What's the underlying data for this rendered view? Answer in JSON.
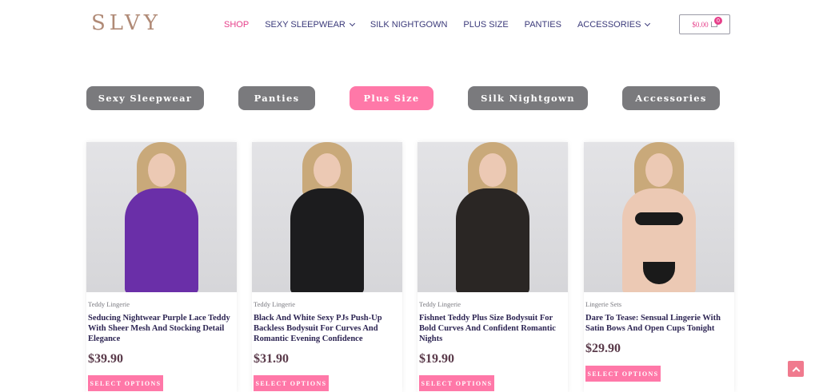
{
  "header": {
    "logo": "SLVY",
    "nav": [
      {
        "label": "SHOP",
        "active": true
      },
      {
        "label": "SEXY SLEEPWEAR",
        "dropdown": true
      },
      {
        "label": "SILK NIGHTGOWN"
      },
      {
        "label": "PLUS SIZE"
      },
      {
        "label": "PANTIES"
      },
      {
        "label": "ACCESSORIES",
        "dropdown": true
      }
    ],
    "cart_total": "$0.00",
    "cart_count": "0"
  },
  "categories": [
    {
      "label": "Sexy Sleepwear",
      "active": false
    },
    {
      "label": "Panties",
      "active": false
    },
    {
      "label": "Plus Size",
      "active": true
    },
    {
      "label": "Silk Nightgown",
      "active": false
    },
    {
      "label": "Accessories",
      "active": false
    }
  ],
  "products": [
    {
      "category": "Teddy Lingerie",
      "title": "Seducing Nightwear Purple Lace Teddy With Sheer Mesh And Stocking Detail Elegance",
      "price": "$39.90",
      "button": "SELECT OPTIONS",
      "color": "#6a2fa8"
    },
    {
      "category": "Teddy Lingerie",
      "title": "Black And White Sexy PJs Push-Up Backless Bodysuit For Curves And Romantic Evening Confidence",
      "price": "$31.90",
      "button": "SELECT OPTIONS",
      "color": "#1c1c1e"
    },
    {
      "category": "Teddy Lingerie",
      "title": "Fishnet Teddy Plus Size Bodysuit For Bold Curves And Confident Romantic Nights",
      "price": "$19.90",
      "button": "SELECT OPTIONS",
      "color": "#2a2624"
    },
    {
      "category": "Lingerie Sets",
      "title": "Dare To Tease: Sensual Lingerie With Satin Bows And Open Cups Tonight",
      "price": "$29.90",
      "button": "SELECT OPTIONS",
      "color": "#1a1a1a"
    }
  ],
  "colors": {
    "accent": "#ff78a8",
    "nav_active": "#e63f8a",
    "nav": "#3b3a7a",
    "button_gray": "#7a7a7d"
  }
}
